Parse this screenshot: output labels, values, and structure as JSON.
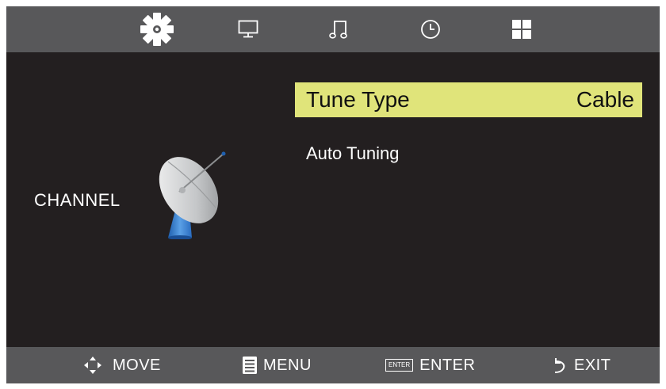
{
  "top_tabs": [
    {
      "icon": "gear-icon",
      "active": true
    },
    {
      "icon": "monitor-icon",
      "active": false
    },
    {
      "icon": "music-note-icon",
      "active": false
    },
    {
      "icon": "clock-icon",
      "active": false
    },
    {
      "icon": "grid-icon",
      "active": false
    }
  ],
  "side_panel": {
    "label": "CHANNEL",
    "icon": "satellite-dish-icon"
  },
  "menu": {
    "items": [
      {
        "label": "Tune Type",
        "value": "Cable",
        "selected": true
      },
      {
        "label": "Auto Tuning",
        "value": "",
        "selected": false
      }
    ]
  },
  "footer": {
    "move_label": "MOVE",
    "menu_label": "MENU",
    "enter_label": "ENTER",
    "enter_badge": "ENTER",
    "exit_label": "EXIT"
  },
  "colors": {
    "bar_background": "#58585a",
    "screen_background": "#231f20",
    "highlight": "#e0e47a",
    "text": "#ffffff"
  }
}
